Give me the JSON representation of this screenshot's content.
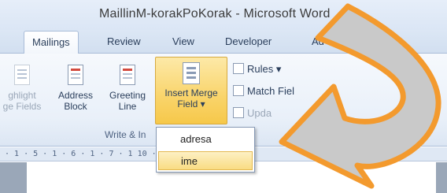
{
  "window": {
    "title": "MaillinM-korakPoKorak - Microsoft Word"
  },
  "tabs": [
    "Mailings",
    "Review",
    "View",
    "Developer",
    "Ad"
  ],
  "ribbon": {
    "highlight": {
      "line1": "ghlight",
      "line2": "ge Fields"
    },
    "address_block": {
      "line1": "Address",
      "line2": "Block"
    },
    "greeting_line": {
      "line1": "Greeting",
      "line2": "Line"
    },
    "insert_merge_field": {
      "line1": "Insert Merge",
      "line2": "Field ▾"
    },
    "rules": "Rules ▾",
    "match_fields": "Match Fiel",
    "update": "Upda",
    "group_label": "Write & In"
  },
  "ruler": {
    "text": "· 1 · 5 · 1 · 6 · 1 · 7 · 1                 10 · 1 · 11 · 1 ·"
  },
  "dropdown": {
    "items": [
      "adresa",
      "ime"
    ],
    "selected": "ime"
  },
  "colors": {
    "accent_arrow": "#f39a2e",
    "arrow_fill": "#c9c9c9",
    "highlight": "#f9d46a"
  }
}
